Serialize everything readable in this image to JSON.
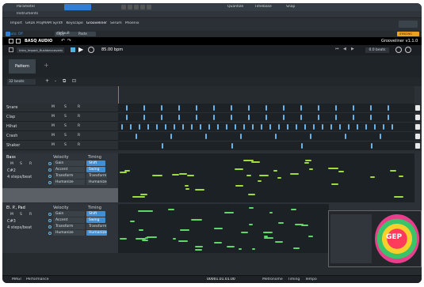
{
  "host": {
    "parameter_label": "Parameter",
    "instruments_label": "Instruments",
    "quantize_label": "Quantize",
    "timebase_label": "Timebase",
    "snap_label": "Snap",
    "tabs": [
      "Import",
      "GRDs ProjMAM Synth",
      "Keyscape",
      "Grooveliner",
      "Serum",
      "Phoenix"
    ],
    "preset_value": "default",
    "auto_label": "Auto: Off",
    "copy_label": "Copy",
    "paste_label": "Paste",
    "sync_label": "SYNCING"
  },
  "plugin": {
    "brand": "BASQ AUDIO",
    "title": "Grooveliner v1.1.0",
    "file_name": "Intro_Impact_Rushbeccaverb",
    "tempo": "85.00 bpm",
    "beat_offset": "0.0 beats",
    "pattern_tab": "Pattern",
    "beats_select": "32 beats"
  },
  "drum_tracks": [
    {
      "name": "Snare",
      "m": "M",
      "s": "S",
      "r": "R"
    },
    {
      "name": "Clap",
      "m": "M",
      "s": "S",
      "r": "R"
    },
    {
      "name": "Hihat",
      "m": "M",
      "s": "S",
      "r": "R"
    },
    {
      "name": "Crash",
      "m": "M",
      "s": "S",
      "r": "R"
    },
    {
      "name": "Shaker",
      "m": "M",
      "s": "S",
      "r": "R"
    }
  ],
  "bass": {
    "name": "Bass",
    "m": "M",
    "s": "S",
    "r": "R",
    "key": "C#2",
    "steps": "4 steps/beat",
    "velocity_header": "Velocity",
    "timing_header": "Timing",
    "velocity_items": [
      "Gain",
      "Accent",
      "Transform",
      "Humanize"
    ],
    "timing_items": [
      "Shift",
      "Swing",
      "Transform",
      "Humanize"
    ]
  },
  "pad": {
    "name": "El. P., Pad",
    "m": "M",
    "s": "S",
    "r": "R",
    "key": "C#3",
    "steps": "4 steps/beat",
    "velocity_header": "Velocity",
    "timing_header": "Timing",
    "velocity_items": [
      "Gain",
      "Accent",
      "Transform",
      "Humanize"
    ],
    "timing_items": [
      "Shift",
      "Swing",
      "Transform",
      "Humanize"
    ]
  },
  "footer": {
    "left_label": "MAGI",
    "performance_label": "Performance",
    "position": "00001.01.01.00",
    "metronome_label": "Metronome",
    "timing_label": "Timing",
    "tempo_label": "Tempo"
  },
  "overlay": {
    "logo_text": "GEP"
  },
  "colors": {
    "accent_blue": "#3f8fd6",
    "drum_beat": "#6ab3e8",
    "bass_note": "#9fdc3c",
    "pad_note": "#5fd86a"
  }
}
